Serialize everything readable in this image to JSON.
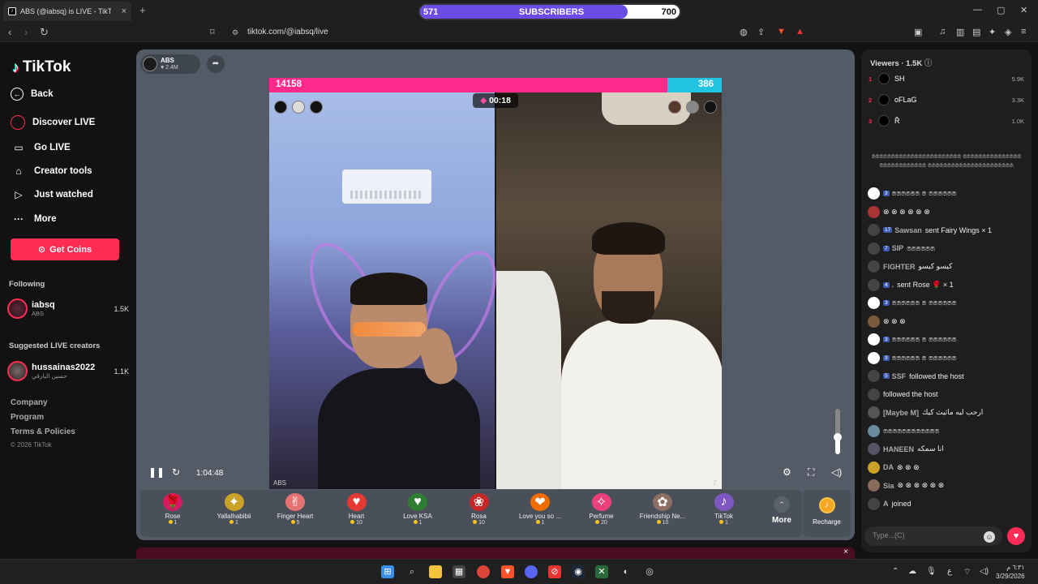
{
  "browser": {
    "tab_title": "ABS (@iabsq) is LIVE - TikTok",
    "url": "tiktok.com/@iabsq/live",
    "subscriber_bar": {
      "left": "571",
      "label": "SUBSCRIBERS",
      "right": "700",
      "progress": 0.8,
      "color": "#6a4de6"
    }
  },
  "sidebar": {
    "logo": "TikTok",
    "nav": [
      {
        "label": "Back",
        "icon": "arrow-left-icon"
      },
      {
        "label": "Discover LIVE",
        "icon": "live-icon"
      },
      {
        "label": "Go LIVE",
        "icon": "camera-icon"
      },
      {
        "label": "Creator tools",
        "icon": "lightbulb-icon"
      },
      {
        "label": "Just watched",
        "icon": "play-icon"
      },
      {
        "label": "More",
        "icon": "ellipsis-icon"
      }
    ],
    "get_coins": "Get Coins",
    "following_heading": "Following",
    "following": [
      {
        "name": "iabsq",
        "sub": "ABS",
        "count": "1.5K"
      }
    ],
    "suggested_heading": "Suggested LIVE creators",
    "suggested": [
      {
        "name": "hussainas2022",
        "sub": "حسين البارقي",
        "count": "1.1K"
      }
    ],
    "footer": [
      "Company",
      "Program",
      "Terms & Policies",
      "© 2026 TikTok"
    ]
  },
  "player": {
    "host_name": "ABS",
    "host_viewers": "2.4M",
    "battle": {
      "left_score": "14158",
      "right_score": "386",
      "timer": "00:18"
    },
    "watermark_left": "ABS",
    "watermark_right": "Z",
    "elapsed": "1:04:48",
    "volume": 0.4,
    "accent": "#fe2c55"
  },
  "gifts": [
    {
      "name": "Rose",
      "price": "1",
      "icon": "🌹",
      "bg": "#d81b60"
    },
    {
      "name": "Yallalhabibii",
      "price": "1",
      "icon": "✦",
      "bg": "#c9a227"
    },
    {
      "name": "Finger Heart",
      "price": "5",
      "icon": "✌",
      "bg": "#e57373"
    },
    {
      "name": "Heart",
      "price": "10",
      "icon": "♥",
      "bg": "#e53935"
    },
    {
      "name": "Love KSA",
      "price": "1",
      "icon": "♥",
      "bg": "#2e7d32"
    },
    {
      "name": "Rosa",
      "price": "10",
      "icon": "❀",
      "bg": "#c62828"
    },
    {
      "name": "Love you so ...",
      "price": "1",
      "icon": "❤",
      "bg": "#ef6c00"
    },
    {
      "name": "Perfume",
      "price": "20",
      "icon": "✧",
      "bg": "#ec407a"
    },
    {
      "name": "Friendship Ne...",
      "price": "10",
      "icon": "✿",
      "bg": "#8d6e63"
    },
    {
      "name": "TikTok",
      "price": "1",
      "icon": "♪",
      "bg": "#7e57c2"
    }
  ],
  "gifts_more": "More",
  "recharge": "Recharge",
  "chat": {
    "viewers_label": "Viewers · 1.5K",
    "top_viewers": [
      {
        "rank": "1",
        "name": "SH",
        "score": "5.9K"
      },
      {
        "rank": "2",
        "name": "oFLaG",
        "score": "3.3K"
      },
      {
        "rank": "3",
        "name": "Ř",
        "score": "1.0K"
      }
    ],
    "pinned": "෧෧෧෧෧෧෧෧෧෧෧෧෧෧෧෧෧෧෧෧෧෧෧ ෧෧෧෧෧෧෧෧෧෧෧෧෧෧෧෧෧෧෧෧෧෧෧෧෧෧෧ ෧෧෧෧෧෧෧෧෧෧෧෧෧෧෧෧෧෧෧෧෧෧",
    "messages": [
      {
        "badge": "3",
        "name": "",
        "text": "෧෧෧෧෧෧ ෧ ෧෧෧෧෧෧",
        "avbg": "#fff"
      },
      {
        "badge": "",
        "name": "",
        "text": "⊗ ⊗ ⊗ ⊗ ⊗ ⊗",
        "avbg": "#a33"
      },
      {
        "badge": "17",
        "name": "Sawsan",
        "text": "sent Fairy Wings × 1",
        "avbg": "#444"
      },
      {
        "badge": "7",
        "name": "SIP",
        "text": "෧෧෧෧෧෧",
        "avbg": "#444"
      },
      {
        "badge": "",
        "name": "FIGHTER",
        "text": "كيسو كيسو",
        "avbg": "#444"
      },
      {
        "badge": "4",
        "name": ".",
        "text": "sent Rose 🌹 × 1",
        "avbg": "#444"
      },
      {
        "badge": "3",
        "name": "",
        "text": "෧෧෧෧෧෧ ෧ ෧෧෧෧෧෧",
        "avbg": "#fff"
      },
      {
        "badge": "",
        "name": "",
        "text": "⊗ ⊗ ⊗",
        "avbg": "#7a5a3a"
      },
      {
        "badge": "3",
        "name": "",
        "text": "෧෧෧෧෧෧ ෧ ෧෧෧෧෧෧",
        "avbg": "#fff"
      },
      {
        "badge": "3",
        "name": "",
        "text": "෧෧෧෧෧෧ ෧ ෧෧෧෧෧෧",
        "avbg": "#fff"
      },
      {
        "badge": "5",
        "name": "SSF",
        "text": "followed the host",
        "avbg": "#444"
      },
      {
        "badge": "",
        "name": "",
        "text": "followed the host",
        "avbg": "#444"
      },
      {
        "badge": "",
        "name": "[Maybe M]",
        "text": "ارحب ليه ماثيث كيك",
        "avbg": "#555"
      },
      {
        "badge": "",
        "name": "",
        "text": "෧෧෧෧෧෧෧෧෧෧෧෧",
        "avbg": "#6a8aa0"
      },
      {
        "badge": "",
        "name": "HANEEN",
        "text": "انا سمكه",
        "avbg": "#556"
      },
      {
        "badge": "",
        "name": "DA",
        "text": "⊗ ⊗ ⊗",
        "avbg": "#c9a227"
      },
      {
        "badge": "",
        "name": "Sia",
        "text": "⊗ ⊗ ⊗ ⊗ ⊗ ⊗",
        "avbg": "#8a6a5a"
      },
      {
        "badge": "",
        "name": "A",
        "text": "joined",
        "avbg": "#444"
      }
    ],
    "input_placeholder": "Type...(C)"
  },
  "taskbar": {
    "time": "٦:٣١ م",
    "date": "3/29/2026",
    "lang": "ع"
  }
}
